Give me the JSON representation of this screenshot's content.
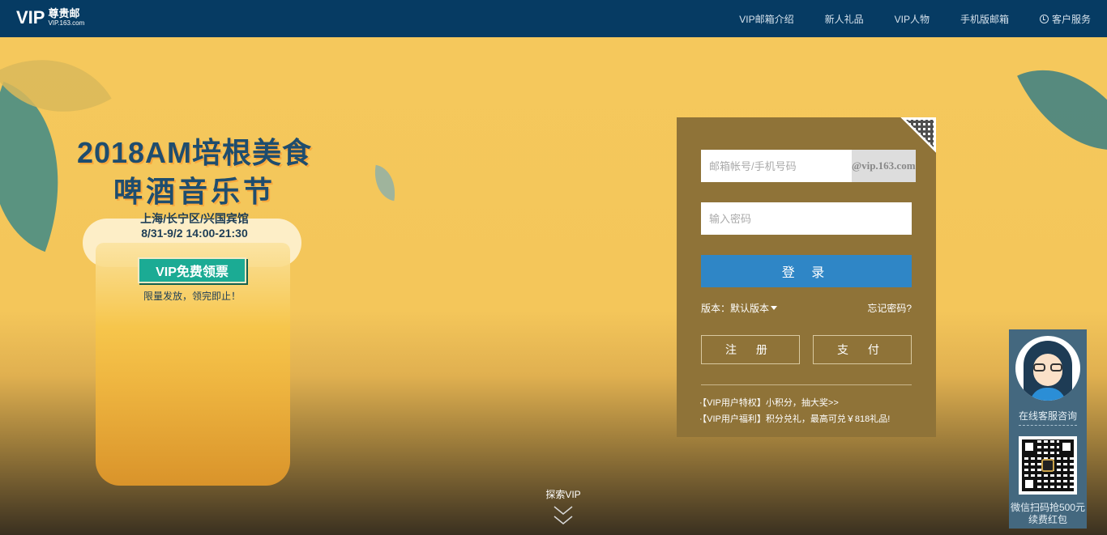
{
  "header": {
    "logo_vip": "VIP",
    "logo_cn": "尊贵邮",
    "logo_url": "VIP.163.com",
    "nav": [
      {
        "label": "VIP邮箱介绍"
      },
      {
        "label": "新人礼品"
      },
      {
        "label": "VIP人物"
      },
      {
        "label": "手机版邮箱"
      },
      {
        "label": "客户服务",
        "icon": "clock-icon"
      }
    ]
  },
  "promo": {
    "title": "2018AM培根美食",
    "subtitle": "啤酒音乐节",
    "venue": "上海/长宁区/兴国宾馆",
    "time": "8/31-9/2 14:00-21:30",
    "ticket_button": "VIP免费领票",
    "note": "限量发放，领完即止！"
  },
  "login": {
    "account_placeholder": "邮箱帐号/手机号码",
    "domain_suffix": "@vip.163.com",
    "password_placeholder": "输入密码",
    "login_button": "登 录",
    "version_label": "版本：默认版本",
    "forgot_password": "忘记密码?",
    "register_button": "注 册",
    "pay_button": "支 付",
    "links": [
      "·【VIP用户特权】小积分，抽大奖>>",
      "·【VIP用户福利】积分兑礼，最高可兑￥818礼品!"
    ]
  },
  "service": {
    "online_label": "在线客服咨询",
    "caption_line1": "微信扫码抢500元",
    "caption_line2": "续费红包"
  },
  "explore": {
    "label": "探索VIP"
  },
  "colors": {
    "header_bg": "#063b63",
    "hero_bg": "#f4c65a",
    "login_panel": "#8f7338",
    "login_button": "#2f86c6",
    "ticket_button": "#1bab94",
    "service_bg": "#44687f"
  }
}
